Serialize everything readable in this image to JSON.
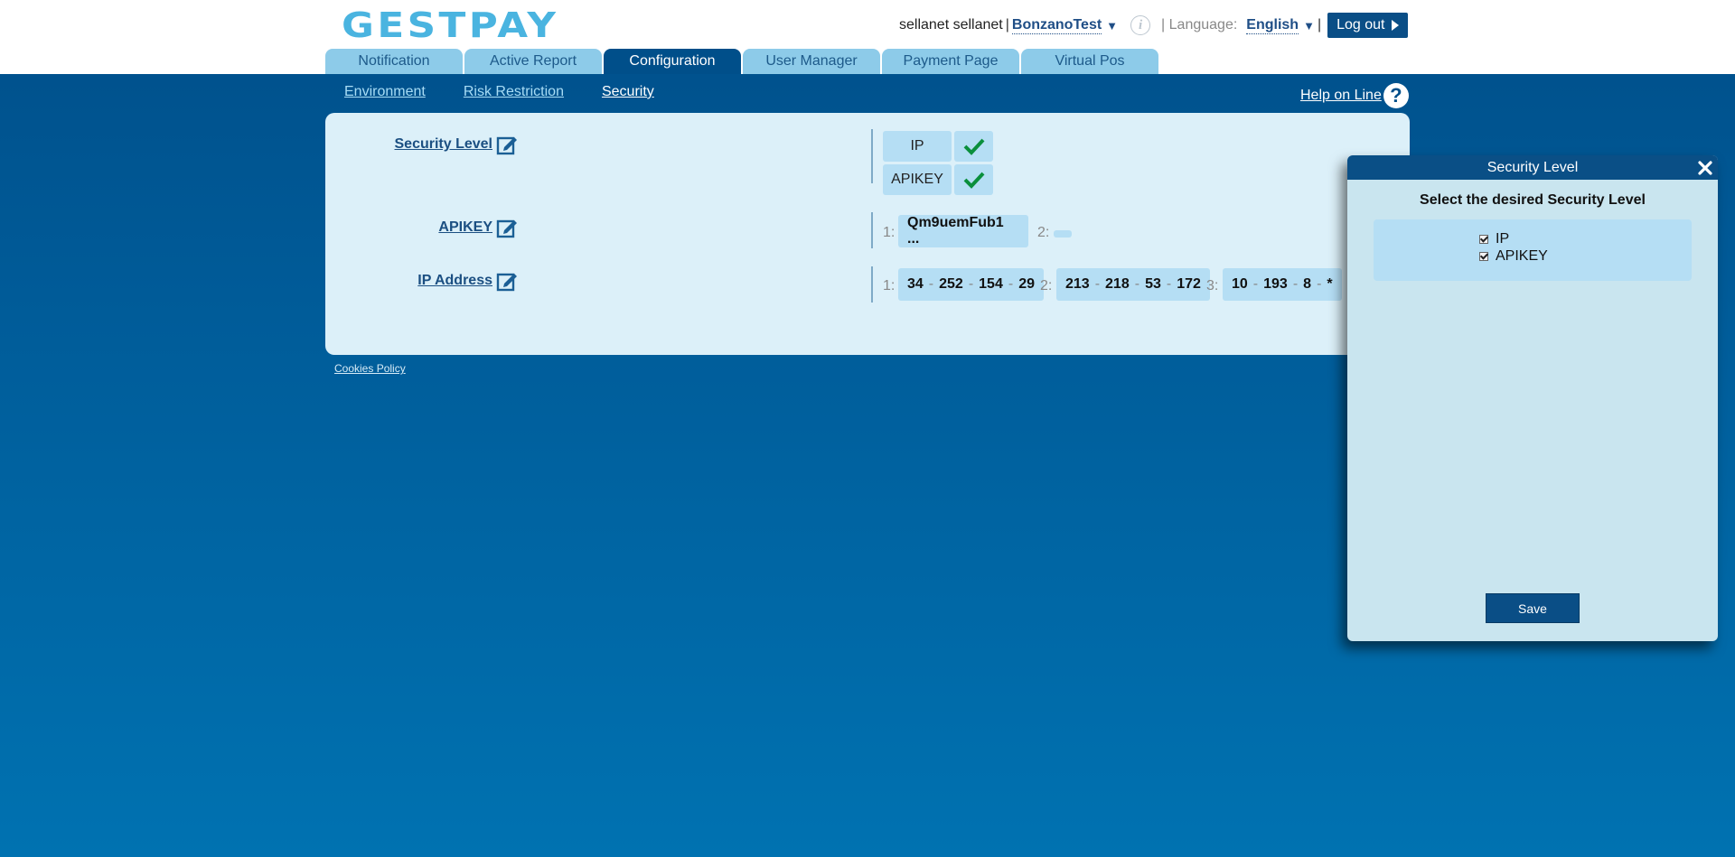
{
  "header": {
    "logo": "GESTPAY",
    "user": "sellanet sellanet",
    "separator": "|",
    "shop": "BonzanoTest",
    "shop_caret": "▼",
    "language_label": "| Language:",
    "language": "English",
    "language_caret": "▼",
    "language_sep": "|",
    "logout": "Log out"
  },
  "tabs": [
    "Notification",
    "Active Report",
    "Configuration",
    "User Manager",
    "Payment Page",
    "Virtual Pos"
  ],
  "active_tab": "Configuration",
  "subnav": [
    "Environment",
    "Risk Restriction",
    "Security"
  ],
  "active_subnav": "Security",
  "help": {
    "label": "Help on Line",
    "icon": "?"
  },
  "security": {
    "security_level_label": "Security Level",
    "levels": [
      "IP",
      "APIKEY"
    ],
    "apikey_label": "APIKEY",
    "apikey": {
      "n1": "1:",
      "value1": "Qm9uemFub1 ...",
      "n2": "2:"
    },
    "ip_label": "IP Address",
    "ips": [
      {
        "n": "1:",
        "parts": [
          "34",
          "252",
          "154",
          "29"
        ]
      },
      {
        "n": "2:",
        "parts": [
          "213",
          "218",
          "53",
          "172"
        ]
      },
      {
        "n": "3:",
        "parts": [
          "10",
          "193",
          "8",
          "*"
        ]
      }
    ],
    "dash": "-"
  },
  "footer": {
    "cookies": "Cookies Policy"
  },
  "dialog": {
    "title": "Security Level",
    "subtitle": "Select the desired Security Level",
    "options": [
      {
        "label": "IP",
        "checked": true
      },
      {
        "label": "APIKEY",
        "checked": true
      }
    ],
    "save": "Save"
  },
  "colors": {
    "brand": "#0a4e86",
    "accent": "#4ab4e0",
    "check": "#0a8f3c"
  }
}
